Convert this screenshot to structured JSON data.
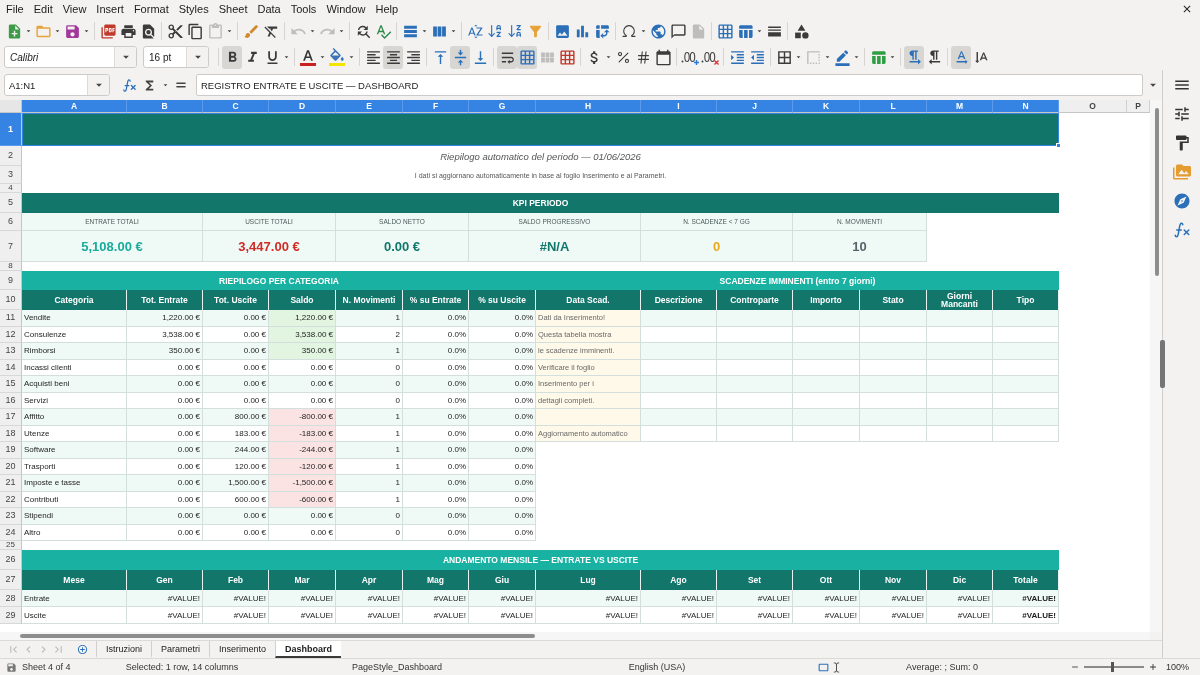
{
  "menu_bar": [
    "File",
    "Edit",
    "View",
    "Insert",
    "Format",
    "Styles",
    "Sheet",
    "Data",
    "Tools",
    "Window",
    "Help"
  ],
  "format_toolbar": {
    "font_name": "Calibri",
    "font_size": "16 pt",
    "bold": true,
    "italic": false,
    "underline": false,
    "align_left": false,
    "align_center": true,
    "align_right": false,
    "align_top": false,
    "align_middle": true,
    "align_bottom": false,
    "wrap_text": true,
    "merge_and_center": true,
    "left_to_right": true,
    "right_to_left": false,
    "text_left_to_right": true,
    "text_top_to_bottom": false
  },
  "formula_bar": {
    "name_box": "A1:N1",
    "formula": "REGISTRO ENTRATE E USCITE — DASHBOARD"
  },
  "sheet": {
    "column_headers": [
      {
        "label": "A",
        "selected": true
      },
      {
        "label": "B",
        "selected": true
      },
      {
        "label": "C",
        "selected": true
      },
      {
        "label": "D",
        "selected": true
      },
      {
        "label": "E",
        "selected": true
      },
      {
        "label": "F",
        "selected": true
      },
      {
        "label": "G",
        "selected": true
      },
      {
        "label": "H",
        "selected": true
      },
      {
        "label": "I",
        "selected": true
      },
      {
        "label": "J",
        "selected": true
      },
      {
        "label": "K",
        "selected": true
      },
      {
        "label": "L",
        "selected": true
      },
      {
        "label": "M",
        "selected": true
      },
      {
        "label": "N",
        "selected": true
      },
      {
        "label": "O",
        "selected": false
      },
      {
        "label": "P",
        "selected": false
      }
    ],
    "row_headers": [
      {
        "label": "1",
        "selected": true
      },
      {
        "label": "2",
        "selected": false
      },
      {
        "label": "3",
        "selected": false
      },
      {
        "label": "4",
        "selected": false
      },
      {
        "label": "5",
        "selected": false
      },
      {
        "label": "6",
        "selected": false
      },
      {
        "label": "7",
        "selected": false
      },
      {
        "label": "8",
        "selected": false
      },
      {
        "label": "9",
        "selected": false
      },
      {
        "label": "10",
        "selected": false
      },
      {
        "label": "11",
        "selected": false
      },
      {
        "label": "12",
        "selected": false
      },
      {
        "label": "13",
        "selected": false
      },
      {
        "label": "14",
        "selected": false
      },
      {
        "label": "15",
        "selected": false
      },
      {
        "label": "16",
        "selected": false
      },
      {
        "label": "17",
        "selected": false
      },
      {
        "label": "18",
        "selected": false
      },
      {
        "label": "19",
        "selected": false
      },
      {
        "label": "20",
        "selected": false
      },
      {
        "label": "21",
        "selected": false
      },
      {
        "label": "22",
        "selected": false
      },
      {
        "label": "23",
        "selected": false
      },
      {
        "label": "24",
        "selected": false
      },
      {
        "label": "25",
        "selected": false
      },
      {
        "label": "26",
        "selected": false
      },
      {
        "label": "27",
        "selected": false
      },
      {
        "label": "28",
        "selected": false
      },
      {
        "label": "29",
        "selected": false
      }
    ],
    "subtitle": "Riepilogo automatico del periodo — 01/06/2026",
    "note": "I dati si aggiornano automaticamente in base al foglio Inserimento e ai Parametri.",
    "kpi_section": {
      "title": "KPI PERIODO",
      "kpis": [
        {
          "label": "ENTRATE TOTALI",
          "value": "5,108.00 €",
          "color": "#1aab9b"
        },
        {
          "label": "USCITE TOTALI",
          "value": "3,447.00 €",
          "color": "#d22b26"
        },
        {
          "label": "SALDO NETTO",
          "value": "0.00 €",
          "color": "#12776b"
        },
        {
          "label": "SALDO PROGRESSIVO",
          "value": "#N/A",
          "color": "#12776c"
        },
        {
          "label": "N. SCADENZE < 7 GG",
          "value": "0",
          "color": "#e8a91c"
        },
        {
          "label": "N. MOVIMENTI",
          "value": "10",
          "color": "#56656b"
        }
      ]
    },
    "category_summary": {
      "title": "RIEPILOGO PER CATEGORIA",
      "columns": [
        "Categoria",
        "Tot. Entrate",
        "Tot. Uscite",
        "Saldo",
        "N. Movimenti",
        "% su Entrate",
        "% su Uscite"
      ],
      "rows": [
        {
          "cells": [
            "Vendite",
            "1,220.00 €",
            "0.00 €",
            "1,220.00 €",
            "1",
            "0.0%",
            "0.0%"
          ],
          "kind": "positive"
        },
        {
          "cells": [
            "Consulenze",
            "3,538.00 €",
            "0.00 €",
            "3,538.00 €",
            "2",
            "0.0%",
            "0.0%"
          ],
          "kind": "positive"
        },
        {
          "cells": [
            "Rimborsi",
            "350.00 €",
            "0.00 €",
            "350.00 €",
            "1",
            "0.0%",
            "0.0%"
          ],
          "kind": "positive"
        },
        {
          "cells": [
            "Incassi clienti",
            "0.00 €",
            "0.00 €",
            "0.00 €",
            "0",
            "0.0%",
            "0.0%"
          ],
          "kind": "zero"
        },
        {
          "cells": [
            "Acquisti beni",
            "0.00 €",
            "0.00 €",
            "0.00 €",
            "0",
            "0.0%",
            "0.0%"
          ],
          "kind": "zero"
        },
        {
          "cells": [
            "Servizi",
            "0.00 €",
            "0.00 €",
            "0.00 €",
            "0",
            "0.0%",
            "0.0%"
          ],
          "kind": "zero"
        },
        {
          "cells": [
            "Affitto",
            "0.00 €",
            "800.00 €",
            "-800.00 €",
            "1",
            "0.0%",
            "0.0%"
          ],
          "kind": "negative"
        },
        {
          "cells": [
            "Utenze",
            "0.00 €",
            "183.00 €",
            "-183.00 €",
            "1",
            "0.0%",
            "0.0%"
          ],
          "kind": "negative"
        },
        {
          "cells": [
            "Software",
            "0.00 €",
            "244.00 €",
            "-244.00 €",
            "1",
            "0.0%",
            "0.0%"
          ],
          "kind": "negative"
        },
        {
          "cells": [
            "Trasporti",
            "0.00 €",
            "120.00 €",
            "-120.00 €",
            "1",
            "0.0%",
            "0.0%"
          ],
          "kind": "negative"
        },
        {
          "cells": [
            "Imposte e tasse",
            "0.00 €",
            "1,500.00 €",
            "-1,500.00 €",
            "1",
            "0.0%",
            "0.0%"
          ],
          "kind": "negative"
        },
        {
          "cells": [
            "Contributi",
            "0.00 €",
            "600.00 €",
            "-600.00 €",
            "1",
            "0.0%",
            "0.0%"
          ],
          "kind": "negative"
        },
        {
          "cells": [
            "Stipendi",
            "0.00 €",
            "0.00 €",
            "0.00 €",
            "0",
            "0.0%",
            "0.0%"
          ],
          "kind": "zero"
        },
        {
          "cells": [
            "Altro",
            "0.00 €",
            "0.00 €",
            "0.00 €",
            "0",
            "0.0%",
            "0.0%"
          ],
          "kind": "zero"
        }
      ]
    },
    "deadlines": {
      "title": "SCADENZE IMMINENTI (entro 7 giorni)",
      "columns": [
        "Data Scad.",
        "Descrizione",
        "Controparte",
        "Importo",
        "Stato",
        "Giorni Mancanti",
        "Tipo"
      ],
      "rows": [
        {
          "note": "Dati da Inserimento!"
        },
        {
          "note": "Questa tabella mostra"
        },
        {
          "note": "le scadenze imminenti."
        },
        {
          "note": "Verificare il foglio"
        },
        {
          "note": "Inserimento per i"
        },
        {
          "note": "dettagli completi."
        },
        {},
        {
          "note": "Aggiornamento automatico"
        }
      ]
    },
    "monthly_trend": {
      "title": "ANDAMENTO MENSILE — ENTRATE VS USCITE",
      "columns": [
        "Mese",
        "Gen",
        "Feb",
        "Mar",
        "Apr",
        "Mag",
        "Giu",
        "Lug",
        "Ago",
        "Set",
        "Ott",
        "Nov",
        "Dic",
        "Totale"
      ],
      "rows": [
        {
          "label": "Entrate",
          "values": [
            "#VALUE!",
            "#VALUE!",
            "#VALUE!",
            "#VALUE!",
            "#VALUE!",
            "#VALUE!",
            "#VALUE!",
            "#VALUE!",
            "#VALUE!",
            "#VALUE!",
            "#VALUE!",
            "#VALUE!"
          ],
          "total": "#VALUE!"
        },
        {
          "label": "Uscite",
          "values": [
            "#VALUE!",
            "#VALUE!",
            "#VALUE!",
            "#VALUE!",
            "#VALUE!",
            "#VALUE!",
            "#VALUE!",
            "#VALUE!",
            "#VALUE!",
            "#VALUE!",
            "#VALUE!",
            "#VALUE!"
          ],
          "total": "#VALUE!"
        }
      ]
    }
  },
  "sheet_tabs": [
    {
      "label": "Istruzioni",
      "selected": false
    },
    {
      "label": "Parametri",
      "selected": false
    },
    {
      "label": "Inserimento",
      "selected": false
    },
    {
      "label": "Dashboard",
      "selected": true
    }
  ],
  "status_bar": {
    "sheet": "Sheet 4 of 4",
    "selection": "Selected: 1 row, 14 columns",
    "page_style": "PageStyle_Dashboard",
    "language": "English (USA)",
    "statistics": "Average: ; Sum: 0",
    "zoom_slider": {
      "level": 0.47
    },
    "zoom": "100%"
  }
}
